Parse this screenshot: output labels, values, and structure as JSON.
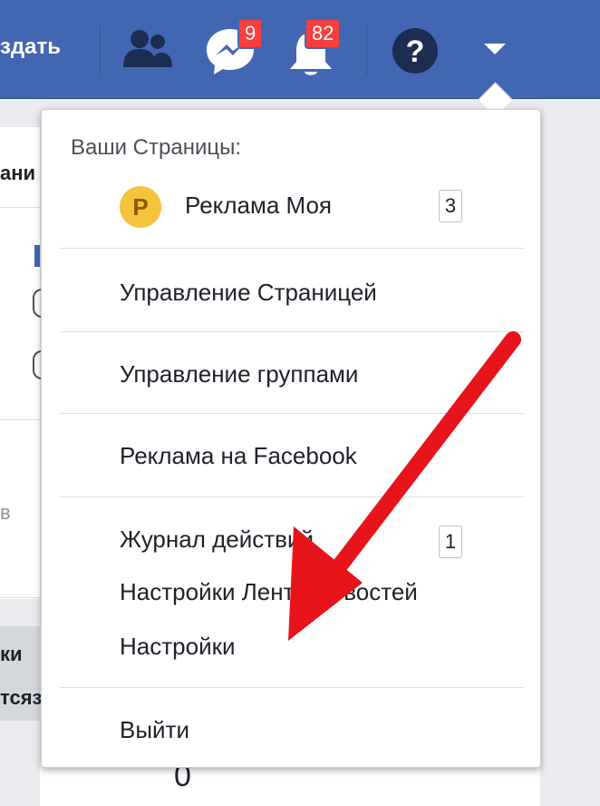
{
  "topbar": {
    "create_label": "здать",
    "messages_badge": "9",
    "notifications_badge": "82",
    "help_icon": "question-icon",
    "friends_icon": "friends-icon",
    "messenger_icon": "messenger-icon",
    "bell_icon": "bell-icon",
    "accent": "#4267b2",
    "badge_color": "#fa3e3e"
  },
  "background_page": {
    "tab_fragment": "ани",
    "text_fragment_b": "в",
    "row_fragment_1": "ки",
    "row_fragment_2": "тсяз",
    "value_fragment": "0"
  },
  "menu": {
    "pages_header": "Ваши Страницы:",
    "page_avatar_letter": "Р",
    "page_name": "Реклама Моя",
    "page_count": "3",
    "items": [
      {
        "label": "Управление Страницей"
      },
      {
        "label": "Управление группами"
      },
      {
        "label": "Реклама на Facebook"
      },
      {
        "label": "Журнал действий",
        "count": "1"
      },
      {
        "label": "Настройки Ленты новостей"
      },
      {
        "label": "Настройки"
      },
      {
        "label": "Выйти"
      }
    ]
  },
  "annotation": {
    "arrow_color": "#e8141b",
    "arrow_icon": "red-arrow-icon"
  }
}
